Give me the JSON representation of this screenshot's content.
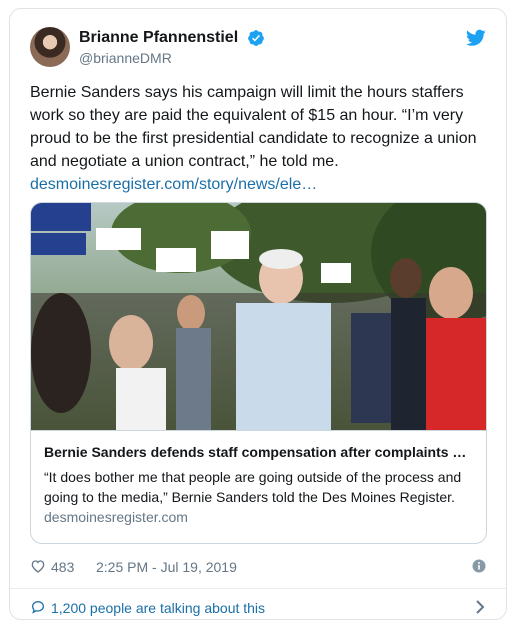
{
  "author": {
    "display_name": "Brianne Pfannenstiel",
    "handle": "@brianneDMR",
    "avatar_icon": "profile-avatar",
    "verified_icon": "verified-badge-icon",
    "brand_icon": "twitter-bird-icon"
  },
  "tweet": {
    "text": "Bernie Sanders says his campaign will limit the hours staffers work so they are paid the equivalent of $15 an hour. “I’m very proud to be the first presidential candidate to recognize a union and negotiate a union contract,” he told me.",
    "link": "desmoinesregister.com/story/news/ele…"
  },
  "link_card": {
    "image_alt": "Bernie Sanders greeting supporters holding Bernie signs",
    "title": "Bernie Sanders defends staff compensation after complaints …",
    "description": "“It does bother me that people are going outside of the process and going to the media,” Bernie Sanders told the Des Moines Register.",
    "domain": "desmoinesregister.com"
  },
  "meta": {
    "likes": "483",
    "timestamp": "2:25 PM - Jul 19, 2019",
    "info_icon": "info-icon",
    "heart_icon": "heart-icon"
  },
  "conversation": {
    "label": "1,200 people are talking about this",
    "icon": "speech-bubble-icon",
    "chevron_icon": "chevron-right-icon"
  },
  "colors": {
    "link": "#1b6fa8",
    "verified": "#1da1f2",
    "secondary_text": "#657786",
    "border": "#ccd6dd"
  }
}
